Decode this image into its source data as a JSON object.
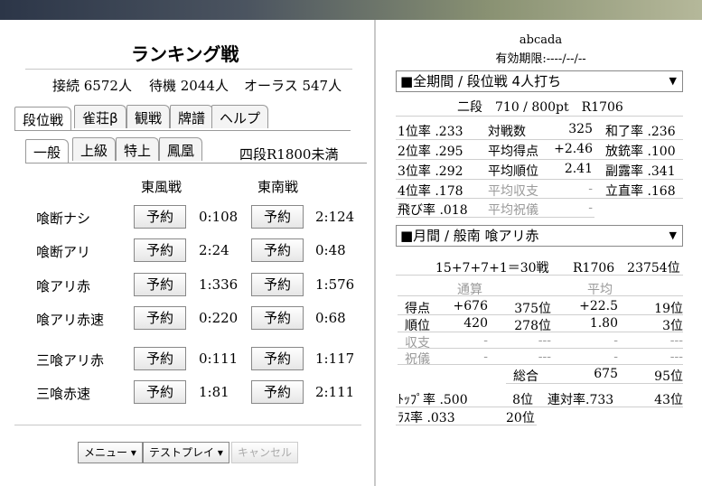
{
  "left": {
    "title": "ランキング戦",
    "online": "接続 6572人",
    "waiting": "待機 2044人",
    "orasu": "オーラス 547人",
    "tabs": [
      {
        "label": "段位戦",
        "active": true
      },
      {
        "label": "雀荘β",
        "active": false
      },
      {
        "label": "観戦",
        "active": false
      },
      {
        "label": "牌譜",
        "active": false
      },
      {
        "label": "ヘルプ",
        "active": false
      }
    ],
    "subtabs": [
      {
        "label": "一般",
        "active": true
      },
      {
        "label": "上級",
        "active": false
      },
      {
        "label": "特上",
        "active": false
      },
      {
        "label": "鳳凰",
        "active": false
      }
    ],
    "rank_condition": "四段R1800未満",
    "col_headers": [
      "東風戦",
      "東南戦"
    ],
    "rows": [
      {
        "label": "喰断ナシ",
        "tonpu_btn": "予約",
        "tonpu_count": "0:108",
        "tonnan_btn": "予約",
        "tonnan_count": "2:124"
      },
      {
        "label": "喰断アリ",
        "tonpu_btn": "予約",
        "tonpu_count": "2:24",
        "tonnan_btn": "予約",
        "tonnan_count": "0:48"
      },
      {
        "label": "喰アリ赤",
        "tonpu_btn": "予約",
        "tonpu_count": "1:336",
        "tonnan_btn": "予約",
        "tonnan_count": "1:576"
      },
      {
        "label": "喰アリ赤速",
        "tonpu_btn": "予約",
        "tonpu_count": "0:220",
        "tonnan_btn": "予約",
        "tonnan_count": "0:68"
      },
      {
        "label": "三喰アリ赤",
        "tonpu_btn": "予約",
        "tonpu_count": "0:111",
        "tonnan_btn": "予約",
        "tonnan_count": "1:117"
      },
      {
        "label": "三喰赤速",
        "tonpu_btn": "予約",
        "tonpu_count": "1:81",
        "tonnan_btn": "予約",
        "tonnan_count": "2:111"
      }
    ],
    "bottom": {
      "menu": "メニュー ▾",
      "testplay": "テストプレイ ▾",
      "cancel": "キャンセル"
    }
  },
  "right": {
    "username": "abcada",
    "expiry": "有効期限:----/--/--",
    "select1": "■全期間 / 段位戦 4人打ち",
    "rank_line": "二段　710 / 800pt　R1706",
    "stats": [
      [
        "1位率 .233",
        "対戦数",
        "325",
        "和了率 .236"
      ],
      [
        "2位率 .295",
        "平均得点",
        "+2.46",
        "放銃率 .100"
      ],
      [
        "3位率 .292",
        "平均順位",
        "2.41",
        "副露率 .341"
      ],
      [
        "4位率 .178",
        "平均収支",
        "-",
        "立直率 .168"
      ],
      [
        "飛び率 .018",
        "平均祝儀",
        "-",
        ""
      ]
    ],
    "select2": "■月間 / 般南 喰アリ赤",
    "summary_games": "15+7+7+1＝30戦",
    "summary_rating": "R1706　23754位",
    "headers": [
      "通算",
      "平均"
    ],
    "table": [
      {
        "label": "得点",
        "total": "+676",
        "total_rank": "375位",
        "avg": "+22.5",
        "avg_rank": "19位"
      },
      {
        "label": "順位",
        "total": "420",
        "total_rank": "278位",
        "avg": "1.80",
        "avg_rank": "3位"
      },
      {
        "label": "収支",
        "total": "-",
        "total_rank": "---",
        "avg": "-",
        "avg_rank": "---"
      },
      {
        "label": "祝儀",
        "total": "-",
        "total_rank": "---",
        "avg": "-",
        "avg_rank": "---"
      }
    ],
    "overall_label": "総合",
    "overall_value": "675",
    "overall_rank": "95位",
    "top_rate": "ﾄｯﾌﾟ率 .500",
    "top_rank": "8位",
    "rentai": "連対率.733",
    "rentai_rank": "43位",
    "las_rate": "ﾗｽ率 .033",
    "las_rank": "20位"
  }
}
